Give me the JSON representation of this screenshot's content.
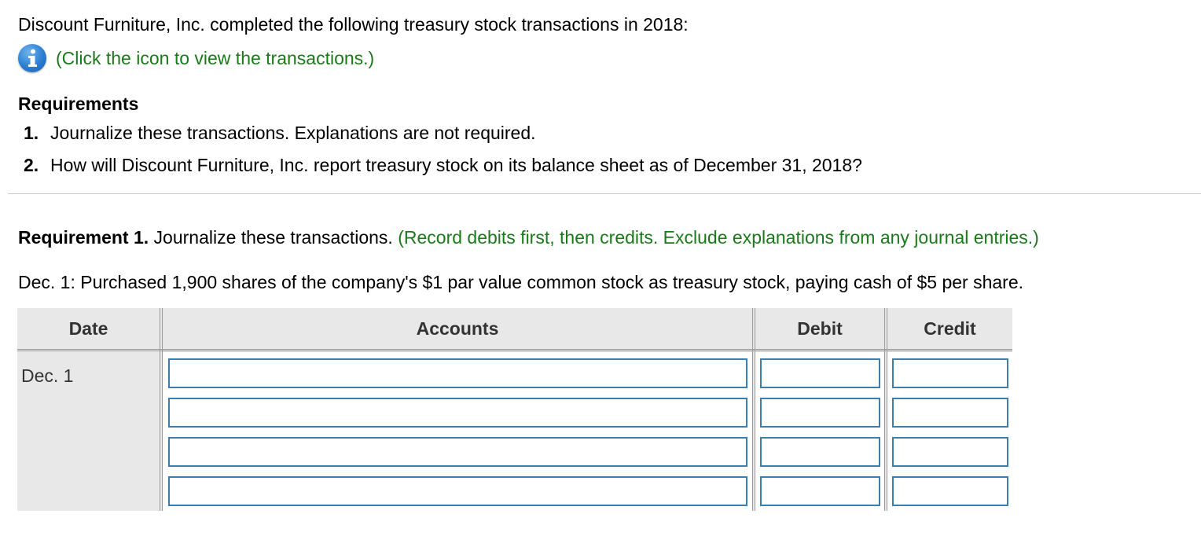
{
  "intro": {
    "text": "Discount Furniture, Inc. completed the following treasury stock transactions in 2018:",
    "info_link": "(Click the icon to view the transactions.)",
    "info_icon": "info-icon"
  },
  "requirements": {
    "title": "Requirements",
    "items": [
      {
        "num": "1.",
        "text": "Journalize these transactions. Explanations are not required."
      },
      {
        "num": "2.",
        "text": "How will Discount Furniture, Inc. report treasury stock on its balance sheet as of December 31, 2018?"
      }
    ]
  },
  "requirement1": {
    "label": "Requirement 1.",
    "text": " Journalize these transactions. ",
    "instruction": "(Record debits first, then credits. Exclude explanations from any journal entries.)"
  },
  "transaction": {
    "text": "Dec. 1: Purchased 1,900 shares of the company's $1 par value common stock as treasury stock, paying cash of $5 per share."
  },
  "journal": {
    "headers": {
      "date": "Date",
      "accounts": "Accounts",
      "debit": "Debit",
      "credit": "Credit"
    },
    "date_value": "Dec. 1",
    "rows": [
      {
        "account": "",
        "debit": "",
        "credit": ""
      },
      {
        "account": "",
        "debit": "",
        "credit": ""
      },
      {
        "account": "",
        "debit": "",
        "credit": ""
      },
      {
        "account": "",
        "debit": "",
        "credit": ""
      }
    ]
  },
  "colors": {
    "green_text": "#1a7a1a",
    "input_border": "#3b7fb0",
    "table_header_bg": "#e8e8e8"
  }
}
